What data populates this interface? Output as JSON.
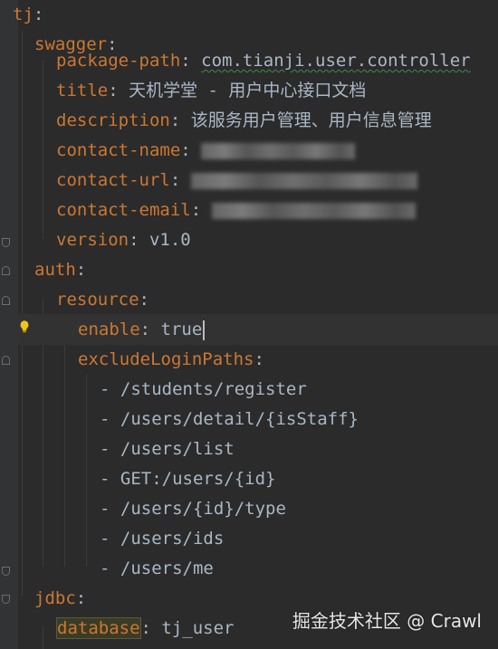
{
  "editor": {
    "language": "yaml",
    "lines": [
      {
        "indent": 0,
        "key": "tj",
        "value": ""
      },
      {
        "indent": 1,
        "key": "swagger",
        "value": ""
      },
      {
        "indent": 2,
        "key": "package-path",
        "value": "com.tianji.user.controller"
      },
      {
        "indent": 2,
        "key": "title",
        "value": "天机学堂 - 用户中心接口文档"
      },
      {
        "indent": 2,
        "key": "description",
        "value": "该服务用户管理、用户信息管理"
      },
      {
        "indent": 2,
        "key": "contact-name",
        "value": ""
      },
      {
        "indent": 2,
        "key": "contact-url",
        "value": ""
      },
      {
        "indent": 2,
        "key": "contact-email",
        "value": ""
      },
      {
        "indent": 2,
        "key": "version",
        "value": "v1.0"
      },
      {
        "indent": 1,
        "key": "auth",
        "value": ""
      },
      {
        "indent": 2,
        "key": "resource",
        "value": ""
      },
      {
        "indent": 3,
        "key": "enable",
        "value": "true"
      },
      {
        "indent": 3,
        "key": "excludeLoginPaths",
        "value": ""
      },
      {
        "indent": 4,
        "item": "/students/register"
      },
      {
        "indent": 4,
        "item": "/users/detail/{isStaff}"
      },
      {
        "indent": 4,
        "item": "/users/list"
      },
      {
        "indent": 4,
        "item": "GET:/users/{id}"
      },
      {
        "indent": 4,
        "item": "/users/{id}/type"
      },
      {
        "indent": 4,
        "item": "/users/ids"
      },
      {
        "indent": 4,
        "item": "/users/me"
      },
      {
        "indent": 1,
        "key": "jdbc",
        "value": ""
      },
      {
        "indent": 2,
        "key": "database",
        "value": "tj_user"
      }
    ]
  },
  "watermark": "掘金技术社区 @ Crawl",
  "colors": {
    "background": "#2b2b2b",
    "key": "#cc7832",
    "value": "#a9b7c6",
    "gutter": "#313335"
  },
  "icons": {
    "intention": "lightbulb-icon",
    "fold": "fold-marker-icon"
  }
}
